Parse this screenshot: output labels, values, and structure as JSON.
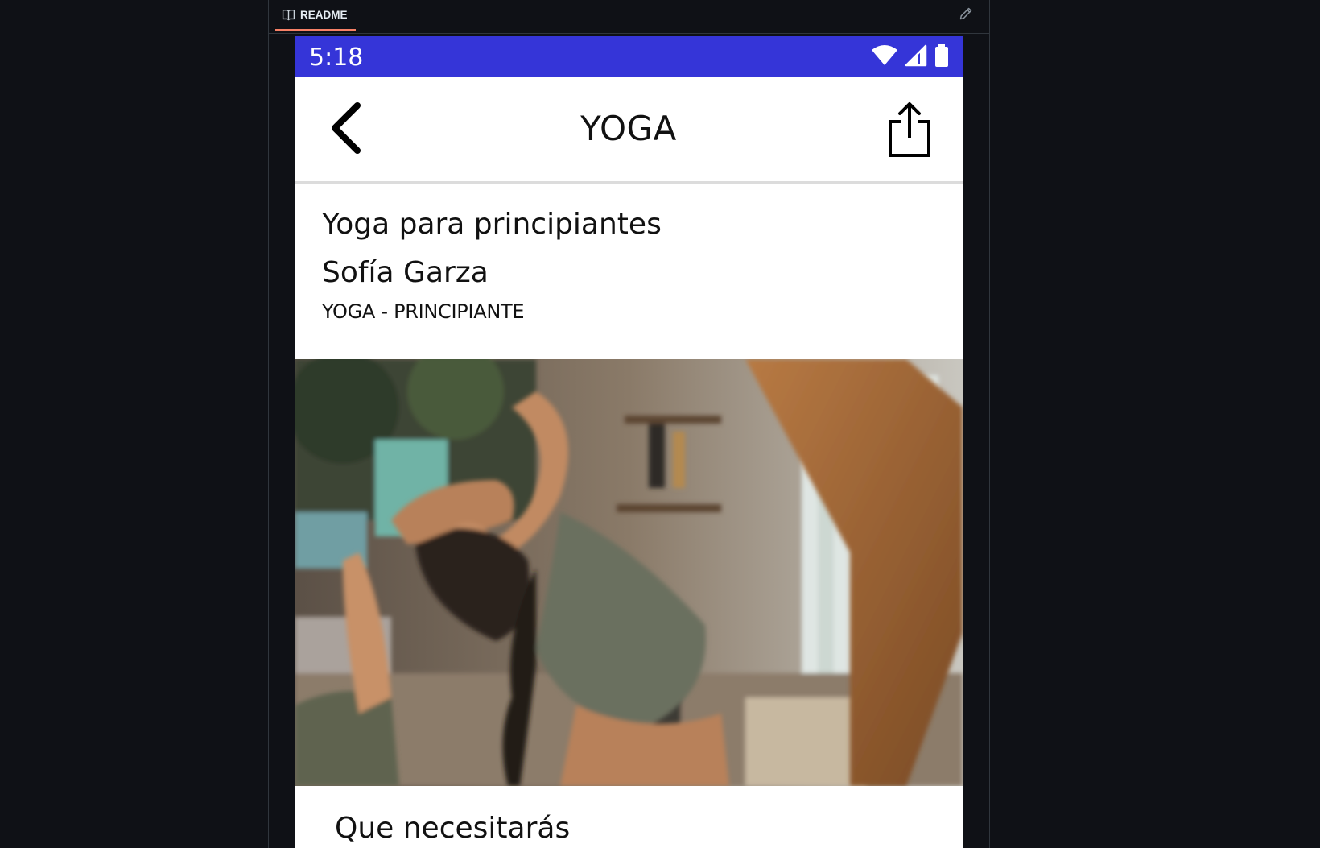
{
  "readme": {
    "tab_label": "README"
  },
  "status_bar": {
    "time": "5:18"
  },
  "app_bar": {
    "title": "YOGA"
  },
  "course": {
    "title": "Yoga para principiantes",
    "instructor": "Sofía Garza",
    "category": "YOGA - PRINCIPIANTE"
  },
  "sections": {
    "needs_title": "Que necesitarás"
  },
  "colors": {
    "status_bar": "#3535d8",
    "readme_accent": "#f78166",
    "background": "#0f1116"
  }
}
